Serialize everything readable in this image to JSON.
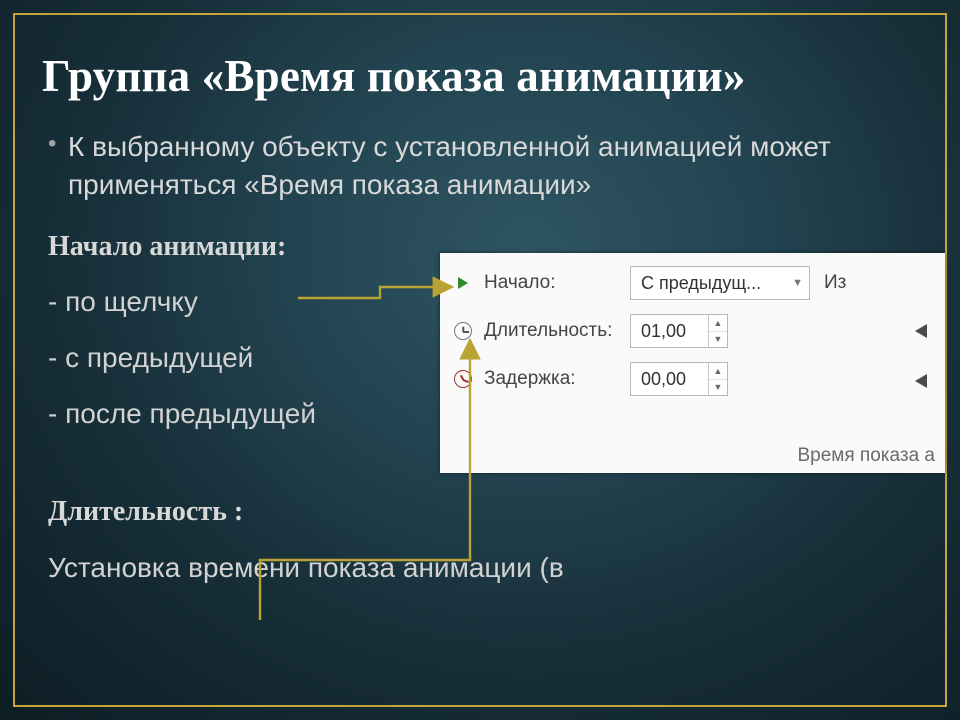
{
  "title": "Группа «Время показа анимации»",
  "intro": "К выбранному объекту с установленной анимацией может применяться «Время показа анимации»",
  "start": {
    "heading": "Начало анимации:",
    "options": [
      "- по щелчку",
      "- с предыдущей",
      "- после предыдущей"
    ]
  },
  "duration": {
    "heading": "Длительность :",
    "desc": "Установка времени показа анимации (в"
  },
  "panel": {
    "rows": [
      {
        "label": "Начало:",
        "value": "С предыдущ...",
        "trail": "Из"
      },
      {
        "label": "Длительность:",
        "value": "01,00"
      },
      {
        "label": "Задержка:",
        "value": "00,00"
      }
    ],
    "caption": "Время показа а"
  }
}
